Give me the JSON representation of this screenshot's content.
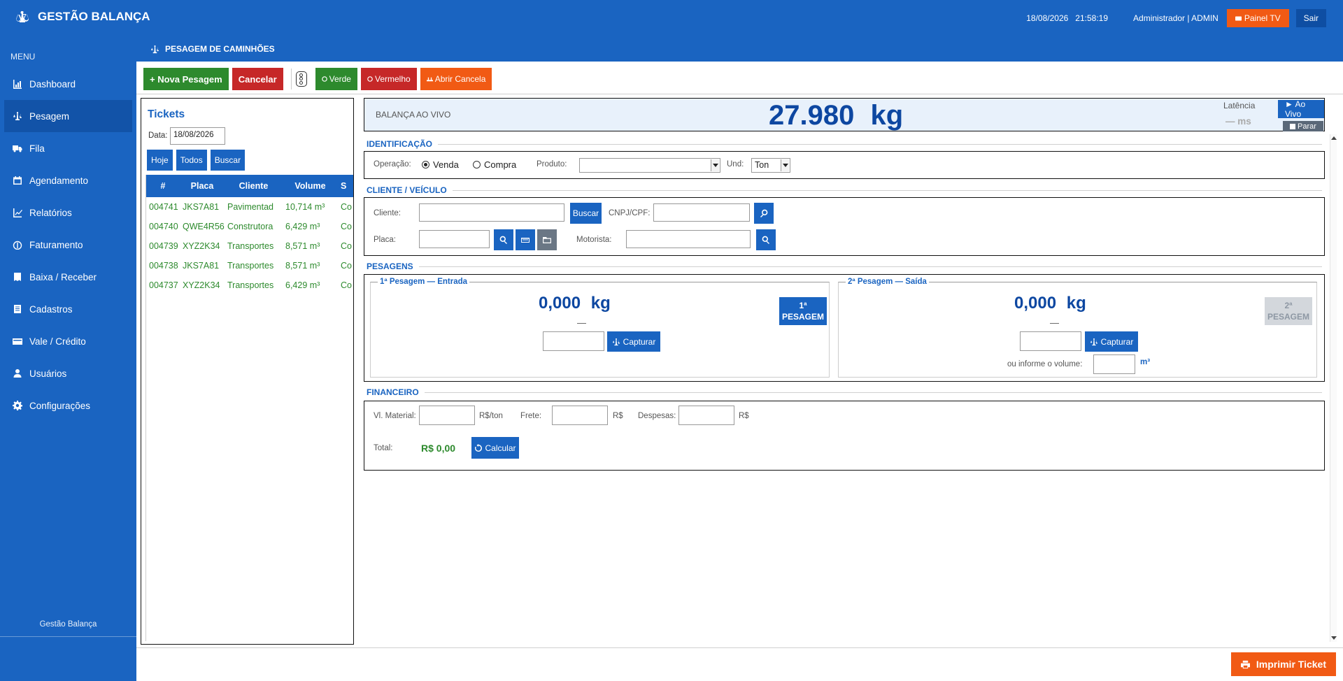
{
  "app": {
    "title": "GESTÃO BALANÇA",
    "footer": "Gestão Balança"
  },
  "topbar": {
    "date": "18/08/2026",
    "time": "21:58:19",
    "user": "Administrador | ADMIN",
    "painel_tv": "Painel TV",
    "sair": "Sair"
  },
  "sidebar": {
    "menu_label": "MENU",
    "items": [
      {
        "label": "Dashboard",
        "icon": "chart-icon"
      },
      {
        "label": "Pesagem",
        "icon": "scale-icon",
        "active": true
      },
      {
        "label": "Fila",
        "icon": "truck-icon"
      },
      {
        "label": "Agendamento",
        "icon": "calendar-icon"
      },
      {
        "label": "Relatórios",
        "icon": "report-icon"
      },
      {
        "label": "Faturamento",
        "icon": "money-icon"
      },
      {
        "label": "Baixa / Receber",
        "icon": "receipt-icon"
      },
      {
        "label": "Cadastros",
        "icon": "list-icon"
      },
      {
        "label": "Vale / Crédito",
        "icon": "card-icon"
      },
      {
        "label": "Usuários",
        "icon": "user-icon"
      },
      {
        "label": "Configurações",
        "icon": "gear-icon"
      }
    ]
  },
  "page": {
    "title": "PESAGEM DE CAMINHÕES"
  },
  "toolbar": {
    "nova": "+ Nova Pesagem",
    "cancelar": "Cancelar",
    "verde": "Verde",
    "vermelho": "Vermelho",
    "abrir": "Abrir Cancela"
  },
  "tickets": {
    "title": "Tickets",
    "date_label": "Data:",
    "date_value": "18/08/2026",
    "btn_hoje": "Hoje",
    "btn_todos": "Todos",
    "btn_buscar": "Buscar",
    "columns": [
      "#",
      "Placa",
      "Cliente",
      "Volume",
      "S"
    ],
    "rows": [
      {
        "num": "004741",
        "placa": "JKS7A81",
        "cliente": "Pavimentad",
        "volume": "10,714 m³",
        "status": "Co"
      },
      {
        "num": "004740",
        "placa": "QWE4R56",
        "cliente": "Construtora",
        "volume": "6,429 m³",
        "status": "Co"
      },
      {
        "num": "004739",
        "placa": "XYZ2K34",
        "cliente": "Transportes",
        "volume": "8,571 m³",
        "status": "Co"
      },
      {
        "num": "004738",
        "placa": "JKS7A81",
        "cliente": "Transportes",
        "volume": "8,571 m³",
        "status": "Co"
      },
      {
        "num": "004737",
        "placa": "XYZ2K34",
        "cliente": "Transportes",
        "volume": "6,429 m³",
        "status": "Co"
      }
    ]
  },
  "live": {
    "label": "BALANÇA AO VIVO",
    "value": "27.980  kg",
    "latency_label": "Latência",
    "latency_value": "— ms",
    "btn_aovivo": "► Ao Vivo",
    "btn_parar": "Parar"
  },
  "ident": {
    "title": "IDENTIFICAÇÃO",
    "operacao_label": "Operação:",
    "venda": "Venda",
    "compra": "Compra",
    "produto_label": "Produto:",
    "produto_value": "",
    "und_label": "Und:",
    "und_value": "Ton"
  },
  "cliente": {
    "title": "CLIENTE / VEÍCULO",
    "cliente_label": "Cliente:",
    "buscar": "Buscar",
    "cnpj_label": "CNPJ/CPF:",
    "placa_label": "Placa:",
    "motorista_label": "Motorista:"
  },
  "pesagens": {
    "title": "PESAGENS",
    "p1": {
      "title": "1ª Pesagem — Entrada",
      "value": "0,000  kg",
      "dash": "—",
      "capture": "Capturar",
      "badge": "1ª PESAGEM"
    },
    "p2": {
      "title": "2ª Pesagem — Saída",
      "value": "0,000  kg",
      "dash": "—",
      "capture": "Capturar",
      "badge": "2ª PESAGEM",
      "volume_label": "ou informe o volume:",
      "volume_unit": "m³"
    }
  },
  "financeiro": {
    "title": "FINANCEIRO",
    "material_label": "Vl. Material:",
    "material_unit": "R$/ton",
    "frete_label": "Frete:",
    "frete_unit": "R$",
    "despesas_label": "Despesas:",
    "despesas_unit": "R$",
    "total_label": "Total:",
    "total_value": "R$ 0,00",
    "calcular": "Calcular"
  },
  "footer": {
    "print": "Imprimir Ticket"
  },
  "colors": {
    "primary": "#1a64c1",
    "green": "#2d8a2d",
    "red": "#c62828",
    "orange": "#f15a14"
  }
}
